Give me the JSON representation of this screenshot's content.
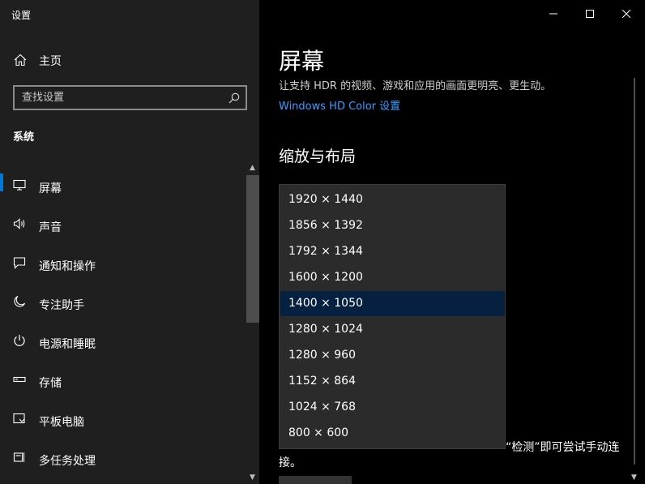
{
  "window": {
    "title": "设置"
  },
  "sidebar": {
    "home_label": "主页",
    "search_placeholder": "查找设置",
    "section": "系统",
    "items": [
      {
        "label": "屏幕",
        "icon": "monitor-icon"
      },
      {
        "label": "声音",
        "icon": "speaker-icon"
      },
      {
        "label": "通知和操作",
        "icon": "message-icon"
      },
      {
        "label": "专注助手",
        "icon": "moon-icon"
      },
      {
        "label": "电源和睡眠",
        "icon": "power-icon"
      },
      {
        "label": "存储",
        "icon": "storage-icon"
      },
      {
        "label": "平板电脑",
        "icon": "tablet-icon"
      },
      {
        "label": "多任务处理",
        "icon": "multitask-icon"
      }
    ]
  },
  "main": {
    "title": "屏幕",
    "subtitle": "让支持 HDR 的视频、游戏和应用的画面更明亮、更生动。",
    "hdr_link": "Windows HD Color 设置",
    "section_heading": "缩放与布局",
    "bottom_text": "“检测”即可尝试手动连接。"
  },
  "resolution_dropdown": {
    "selected": "1400 × 1050",
    "options": [
      "1920 × 1440",
      "1856 × 1392",
      "1792 × 1344",
      "1600 × 1200",
      "1400 × 1050",
      "1280 × 1024",
      "1280 × 960",
      "1152 × 864",
      "1024 × 768",
      "800 × 600"
    ]
  },
  "colors": {
    "accent": "#0078d7",
    "link": "#3a9cff",
    "selected_option": "#05213f"
  }
}
